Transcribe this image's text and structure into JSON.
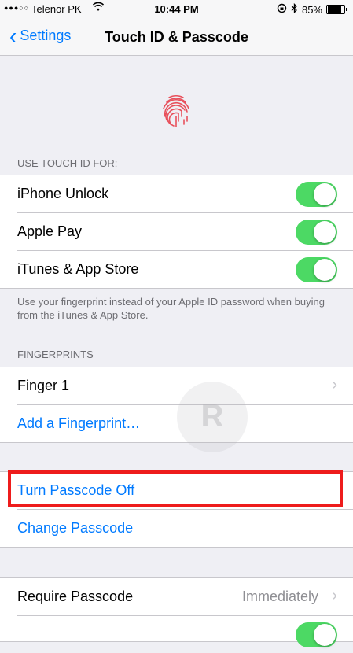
{
  "status_bar": {
    "signal": "●●●○○",
    "carrier": "Telenor PK",
    "time": "10:44 PM",
    "battery_percent": "85%",
    "battery_level": 0.85
  },
  "nav": {
    "back_label": "Settings",
    "title": "Touch ID & Passcode"
  },
  "touch_id": {
    "header": "USE TOUCH ID FOR:",
    "items": [
      {
        "label": "iPhone Unlock",
        "on": true
      },
      {
        "label": "Apple Pay",
        "on": true
      },
      {
        "label": "iTunes & App Store",
        "on": true
      }
    ],
    "footer": "Use your fingerprint instead of your Apple ID password when buying from the iTunes & App Store."
  },
  "fingerprints": {
    "header": "FINGERPRINTS",
    "items": [
      {
        "label": "Finger 1"
      },
      {
        "label": "Add a Fingerprint…"
      }
    ]
  },
  "passcode": {
    "turn_off_label": "Turn Passcode Off",
    "change_label": "Change Passcode"
  },
  "require": {
    "label": "Require Passcode",
    "value": "Immediately"
  },
  "colors": {
    "accent": "#007aff",
    "toggle_on": "#4cd964",
    "highlight": "#ee1c1c",
    "fingerprint": "#e8505b"
  }
}
